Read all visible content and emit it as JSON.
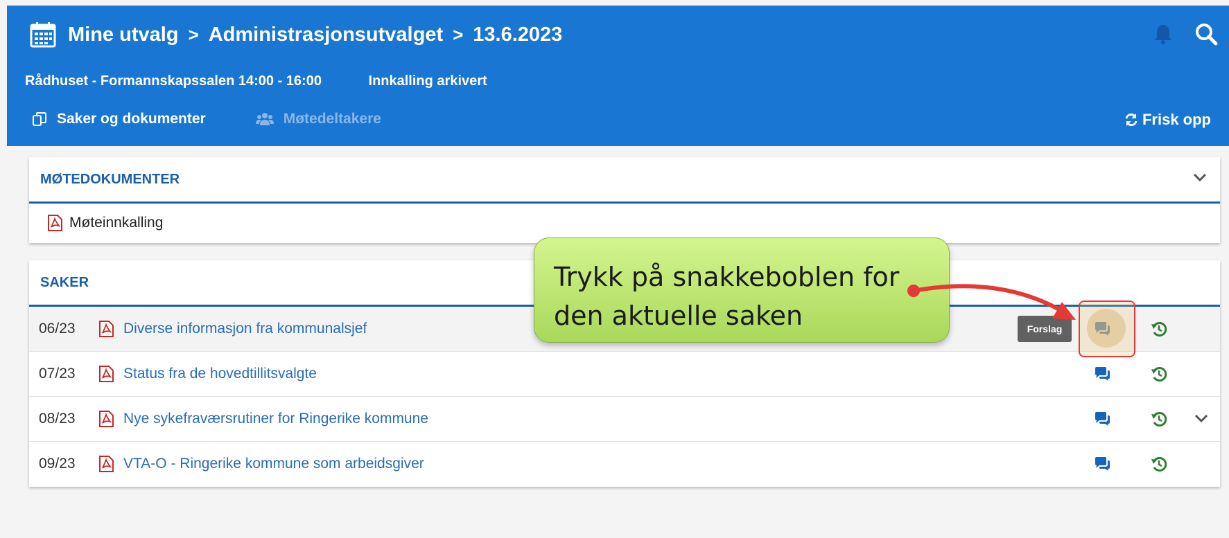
{
  "header": {
    "breadcrumbs": [
      "Mine utvalg",
      "Administrasjonsutvalget",
      "13.6.2023"
    ],
    "separator": ">",
    "location_time": "Rådhuset - Formannskapssalen 14:00 - 16:00",
    "status": "Innkalling arkivert",
    "nav": {
      "cases_docs": "Saker og dokumenter",
      "participants": "Møtedeltakere"
    },
    "refresh": "Frisk opp",
    "icons": [
      "calendar-icon",
      "bell-icon",
      "search-icon"
    ]
  },
  "meeting_docs": {
    "heading": "MØTEDOKUMENTER",
    "items": [
      "Møteinnkalling"
    ]
  },
  "cases": {
    "heading": "SAKER",
    "rows": [
      {
        "number": "06/23",
        "title": "Diverse informasjon fra kommunalsjef"
      },
      {
        "number": "07/23",
        "title": "Status fra de hovedtillitsvalgte"
      },
      {
        "number": "08/23",
        "title": "Nye sykefraværsrutiner for Ringerike kommune"
      },
      {
        "number": "09/23",
        "title": "VTA-O - Ringerike kommune som arbeidsgiver"
      }
    ]
  },
  "tooltip": "Forslag",
  "callout": {
    "line1": "Trykk på snakkeboblen for",
    "line2": "den aktuelle saken"
  },
  "colors": {
    "header_bg": "#1976d2",
    "link": "#2a6db5",
    "chat_icon": "#1976d2",
    "history_icon": "#2e7d32",
    "annotation": "#e53935"
  }
}
